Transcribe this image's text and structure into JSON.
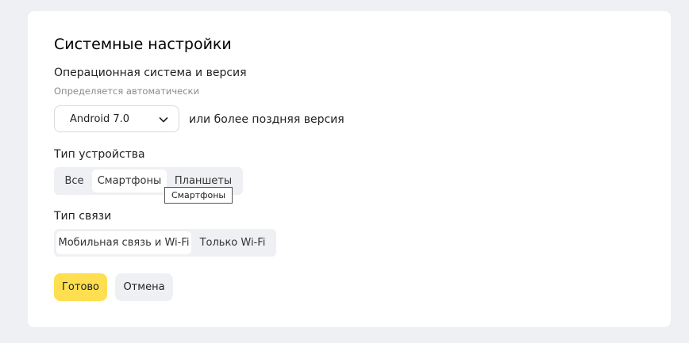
{
  "settings": {
    "title": "Системные настройки",
    "os": {
      "label": "Операционная система и версия",
      "hint": "Определяется автоматически",
      "selected_version": "Android 7.0",
      "after_text": "или более поздняя версия"
    },
    "device_type": {
      "label": "Тип устройства",
      "options": [
        "Все",
        "Смартфоны",
        "Планшеты"
      ],
      "active": "Смартфоны",
      "tooltip": "Смартфоны"
    },
    "connection": {
      "label": "Тип связи",
      "options": [
        "Мобильная связь и Wi-Fi",
        "Только Wi-Fi"
      ],
      "active": "Мобильная связь и Wi-Fi"
    },
    "actions": {
      "done_label": "Готово",
      "cancel_label": "Отмена"
    }
  },
  "colors": {
    "page_bg": "#eef0f4",
    "card_bg": "#ffffff",
    "primary_button": "#ffdf4f",
    "segment_bg": "#eef0f4"
  },
  "icons": {
    "select_arrow": "chevron-down-icon"
  }
}
